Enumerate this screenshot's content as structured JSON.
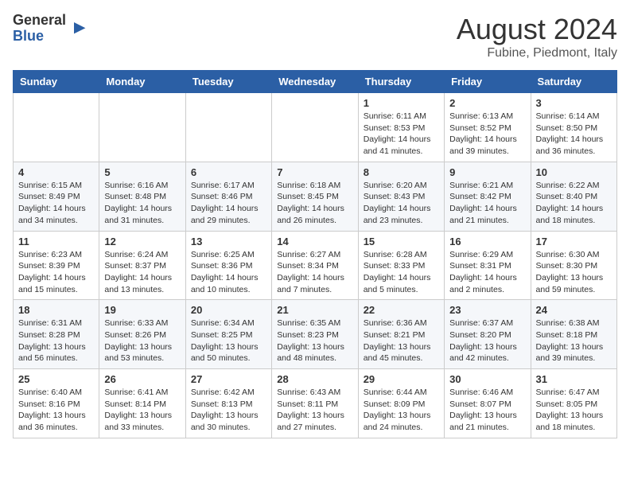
{
  "header": {
    "logo_general": "General",
    "logo_blue": "Blue",
    "title": "August 2024",
    "location": "Fubine, Piedmont, Italy"
  },
  "days_of_week": [
    "Sunday",
    "Monday",
    "Tuesday",
    "Wednesday",
    "Thursday",
    "Friday",
    "Saturday"
  ],
  "weeks": [
    [
      {
        "day": "",
        "info": ""
      },
      {
        "day": "",
        "info": ""
      },
      {
        "day": "",
        "info": ""
      },
      {
        "day": "",
        "info": ""
      },
      {
        "day": "1",
        "info": "Sunrise: 6:11 AM\nSunset: 8:53 PM\nDaylight: 14 hours\nand 41 minutes."
      },
      {
        "day": "2",
        "info": "Sunrise: 6:13 AM\nSunset: 8:52 PM\nDaylight: 14 hours\nand 39 minutes."
      },
      {
        "day": "3",
        "info": "Sunrise: 6:14 AM\nSunset: 8:50 PM\nDaylight: 14 hours\nand 36 minutes."
      }
    ],
    [
      {
        "day": "4",
        "info": "Sunrise: 6:15 AM\nSunset: 8:49 PM\nDaylight: 14 hours\nand 34 minutes."
      },
      {
        "day": "5",
        "info": "Sunrise: 6:16 AM\nSunset: 8:48 PM\nDaylight: 14 hours\nand 31 minutes."
      },
      {
        "day": "6",
        "info": "Sunrise: 6:17 AM\nSunset: 8:46 PM\nDaylight: 14 hours\nand 29 minutes."
      },
      {
        "day": "7",
        "info": "Sunrise: 6:18 AM\nSunset: 8:45 PM\nDaylight: 14 hours\nand 26 minutes."
      },
      {
        "day": "8",
        "info": "Sunrise: 6:20 AM\nSunset: 8:43 PM\nDaylight: 14 hours\nand 23 minutes."
      },
      {
        "day": "9",
        "info": "Sunrise: 6:21 AM\nSunset: 8:42 PM\nDaylight: 14 hours\nand 21 minutes."
      },
      {
        "day": "10",
        "info": "Sunrise: 6:22 AM\nSunset: 8:40 PM\nDaylight: 14 hours\nand 18 minutes."
      }
    ],
    [
      {
        "day": "11",
        "info": "Sunrise: 6:23 AM\nSunset: 8:39 PM\nDaylight: 14 hours\nand 15 minutes."
      },
      {
        "day": "12",
        "info": "Sunrise: 6:24 AM\nSunset: 8:37 PM\nDaylight: 14 hours\nand 13 minutes."
      },
      {
        "day": "13",
        "info": "Sunrise: 6:25 AM\nSunset: 8:36 PM\nDaylight: 14 hours\nand 10 minutes."
      },
      {
        "day": "14",
        "info": "Sunrise: 6:27 AM\nSunset: 8:34 PM\nDaylight: 14 hours\nand 7 minutes."
      },
      {
        "day": "15",
        "info": "Sunrise: 6:28 AM\nSunset: 8:33 PM\nDaylight: 14 hours\nand 5 minutes."
      },
      {
        "day": "16",
        "info": "Sunrise: 6:29 AM\nSunset: 8:31 PM\nDaylight: 14 hours\nand 2 minutes."
      },
      {
        "day": "17",
        "info": "Sunrise: 6:30 AM\nSunset: 8:30 PM\nDaylight: 13 hours\nand 59 minutes."
      }
    ],
    [
      {
        "day": "18",
        "info": "Sunrise: 6:31 AM\nSunset: 8:28 PM\nDaylight: 13 hours\nand 56 minutes."
      },
      {
        "day": "19",
        "info": "Sunrise: 6:33 AM\nSunset: 8:26 PM\nDaylight: 13 hours\nand 53 minutes."
      },
      {
        "day": "20",
        "info": "Sunrise: 6:34 AM\nSunset: 8:25 PM\nDaylight: 13 hours\nand 50 minutes."
      },
      {
        "day": "21",
        "info": "Sunrise: 6:35 AM\nSunset: 8:23 PM\nDaylight: 13 hours\nand 48 minutes."
      },
      {
        "day": "22",
        "info": "Sunrise: 6:36 AM\nSunset: 8:21 PM\nDaylight: 13 hours\nand 45 minutes."
      },
      {
        "day": "23",
        "info": "Sunrise: 6:37 AM\nSunset: 8:20 PM\nDaylight: 13 hours\nand 42 minutes."
      },
      {
        "day": "24",
        "info": "Sunrise: 6:38 AM\nSunset: 8:18 PM\nDaylight: 13 hours\nand 39 minutes."
      }
    ],
    [
      {
        "day": "25",
        "info": "Sunrise: 6:40 AM\nSunset: 8:16 PM\nDaylight: 13 hours\nand 36 minutes."
      },
      {
        "day": "26",
        "info": "Sunrise: 6:41 AM\nSunset: 8:14 PM\nDaylight: 13 hours\nand 33 minutes."
      },
      {
        "day": "27",
        "info": "Sunrise: 6:42 AM\nSunset: 8:13 PM\nDaylight: 13 hours\nand 30 minutes."
      },
      {
        "day": "28",
        "info": "Sunrise: 6:43 AM\nSunset: 8:11 PM\nDaylight: 13 hours\nand 27 minutes."
      },
      {
        "day": "29",
        "info": "Sunrise: 6:44 AM\nSunset: 8:09 PM\nDaylight: 13 hours\nand 24 minutes."
      },
      {
        "day": "30",
        "info": "Sunrise: 6:46 AM\nSunset: 8:07 PM\nDaylight: 13 hours\nand 21 minutes."
      },
      {
        "day": "31",
        "info": "Sunrise: 6:47 AM\nSunset: 8:05 PM\nDaylight: 13 hours\nand 18 minutes."
      }
    ]
  ]
}
